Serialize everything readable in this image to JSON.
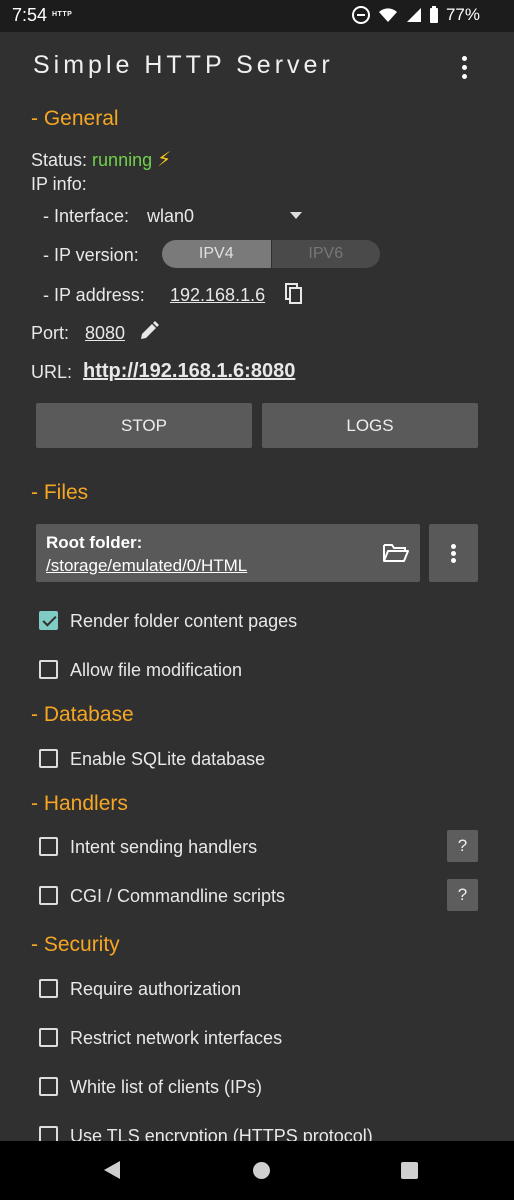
{
  "status_bar": {
    "time": "7:54",
    "http_badge": "HTTP",
    "battery": "77%"
  },
  "app": {
    "title": "Simple HTTP Server"
  },
  "general": {
    "section": "- General",
    "status_label": "Status:",
    "status_value": "running",
    "ip_info_label": "IP info:",
    "interface_label": "- Interface:",
    "interface_value": "wlan0",
    "ip_version_label": "- IP version:",
    "ip_versions": [
      "IPV4",
      "IPV6"
    ],
    "ip_version_selected": "IPV4",
    "ip_address_label": "- IP address:",
    "ip_address_value": "192.168.1.6",
    "port_label": "Port:",
    "port_value": "8080",
    "url_label": "URL:",
    "url_value": "http://192.168.1.6:8080",
    "stop_button": "STOP",
    "logs_button": "LOGS"
  },
  "files": {
    "section": "- Files",
    "root_folder_label": "Root folder:",
    "root_folder_path": "/storage/emulated/0/HTML",
    "render_folder_pages": {
      "label": "Render folder content pages",
      "checked": true
    },
    "allow_modification": {
      "label": "Allow file modification",
      "checked": false
    }
  },
  "database": {
    "section": "- Database",
    "enable_sqlite": {
      "label": "Enable SQLite database",
      "checked": false
    }
  },
  "handlers": {
    "section": "- Handlers",
    "intent_handlers": {
      "label": "Intent sending handlers",
      "checked": false
    },
    "cgi_scripts": {
      "label": "CGI / Commandline scripts",
      "checked": false
    },
    "help_label": "?"
  },
  "security": {
    "section": "- Security",
    "require_auth": {
      "label": "Require authorization",
      "checked": false
    },
    "restrict_interfaces": {
      "label": "Restrict network interfaces",
      "checked": false
    },
    "whitelist_clients": {
      "label": "White list of clients (IPs)",
      "checked": false
    },
    "use_tls": {
      "label": "Use TLS encryption (HTTPS protocol)",
      "checked": false
    }
  },
  "colors": {
    "background": "#303030",
    "section_accent": "#f5a623",
    "running_green": "#6fd14a",
    "checkbox_checked": "#80cbc4"
  }
}
